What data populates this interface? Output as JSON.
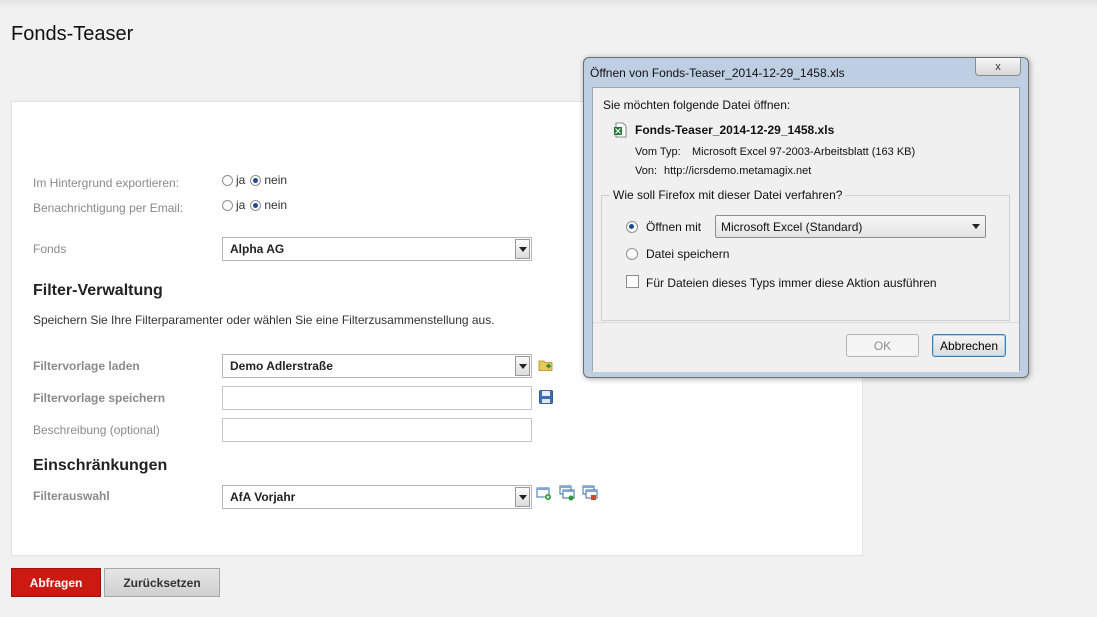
{
  "page": {
    "title": "Fonds-Teaser"
  },
  "form": {
    "export_bg": {
      "label": "Im Hintergrund exportieren:",
      "yes": "ja",
      "no": "nein",
      "selected": "nein"
    },
    "email_notify": {
      "label": "Benachrichtigung per Email:",
      "yes": "ja",
      "no": "nein",
      "selected": "nein"
    },
    "fonds": {
      "label": "Fonds",
      "value": "Alpha AG"
    },
    "filter_section": {
      "title": "Filter-Verwaltung",
      "description": "Speichern Sie Ihre Filterparamenter oder wählen Sie eine Filterzusammenstellung aus.",
      "load_label": "Filtervorlage laden",
      "load_value": "Demo Adlerstraße",
      "save_label": "Filtervorlage speichern",
      "save_value": "",
      "desc_label": "Beschreibung (optional)",
      "desc_value": ""
    },
    "restrictions": {
      "title": "Einschränkungen",
      "filter_label": "Filterauswahl",
      "filter_value": "AfA Vorjahr"
    }
  },
  "buttons": {
    "query": "Abfragen",
    "reset": "Zurücksetzen"
  },
  "dialog": {
    "title": "Öffnen von Fonds-Teaser_2014-12-29_1458.xls",
    "close": "x",
    "intro": "Sie möchten folgende Datei öffnen:",
    "file_name": "Fonds-Teaser_2014-12-29_1458.xls",
    "type_label": "Vom Typ:",
    "type_value": "Microsoft Excel 97-2003-Arbeitsblatt (163 KB)",
    "from_label": "Von:",
    "from_value": "http://icrsdemo.metamagix.net",
    "question": "Wie soll Firefox mit dieser Datei verfahren?",
    "open_with_label": "Öffnen mit",
    "open_with_value": "Microsoft Excel (Standard)",
    "save_file_label": "Datei speichern",
    "always_label": "Für Dateien dieses Typs immer diese Aktion ausführen",
    "ok": "OK",
    "cancel": "Abbrechen"
  },
  "colors": {
    "primary_button": "#cc1a13",
    "dialog_frame": "#bfcfe3"
  }
}
